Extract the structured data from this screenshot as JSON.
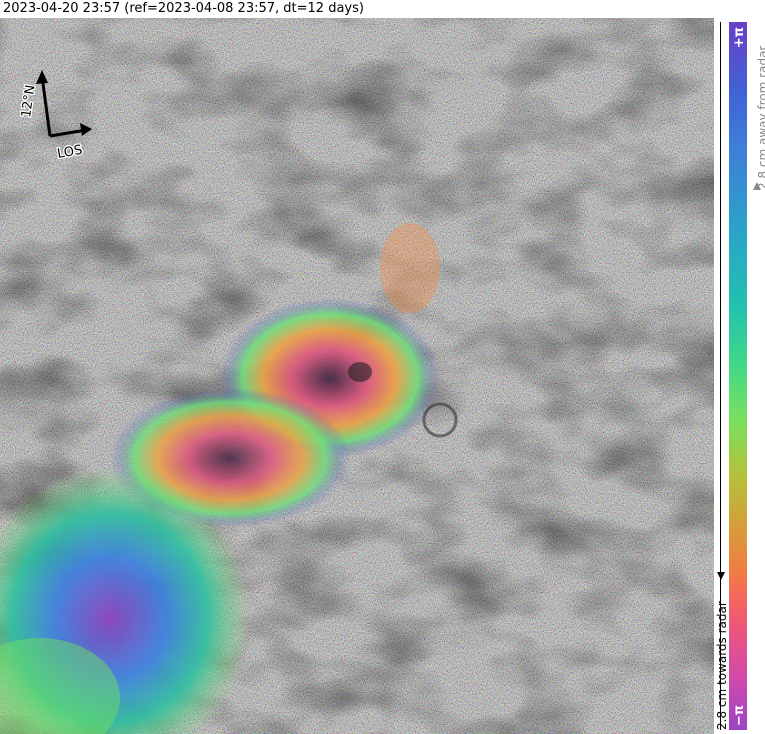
{
  "title": "2023-04-20 23:57 (ref=2023-04-08 23:57, dt=12 days)",
  "compass": {
    "north_label": "12°N",
    "los_label": "LOS"
  },
  "colorbar": {
    "top_label": "+π",
    "bottom_label": "−π",
    "away_label": "2.8 cm away from radar",
    "towards_label": "2.8 cm towards radar",
    "colors": [
      "#6a3fc6",
      "#3f7fd8",
      "#22c0b0",
      "#78e060",
      "#d99a3a",
      "#f25a6e",
      "#9d43c6"
    ]
  }
}
